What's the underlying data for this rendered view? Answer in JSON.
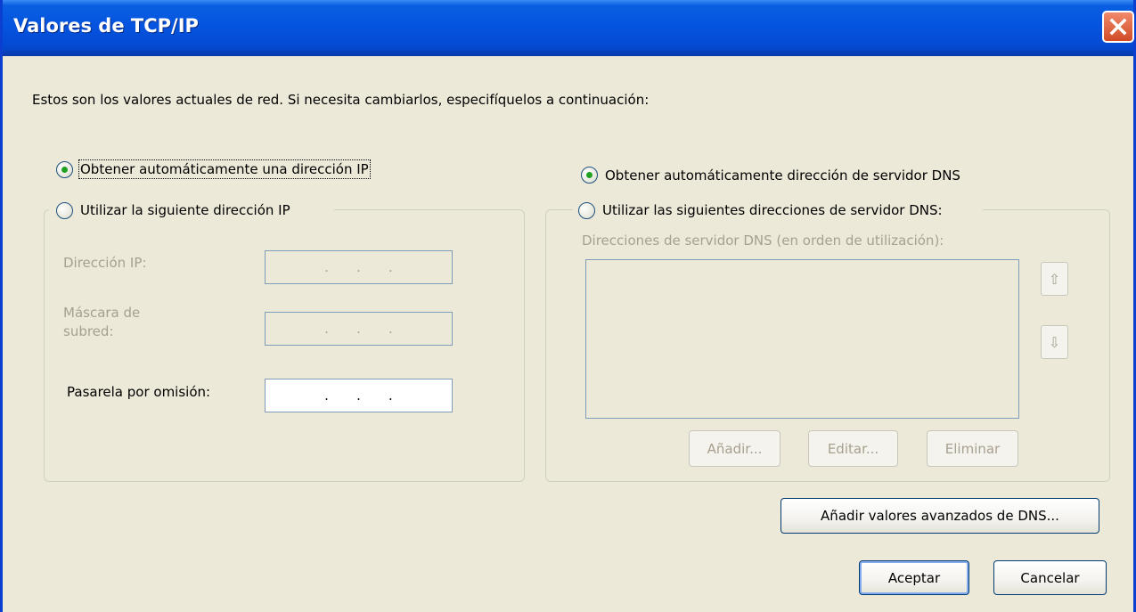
{
  "window": {
    "title": "Valores de TCP/IP",
    "close_icon": "close-icon"
  },
  "intro_text": "Estos son los valores actuales de red.  Si necesita cambiarlos, especifíquelos a continuación:",
  "ip": {
    "auto_option": "Obtener automáticamente una dirección IP",
    "auto_selected": true,
    "manual_option": "Utilizar la siguiente dirección IP",
    "ip_address_label": "Dirección IP:",
    "subnet_label_line1": "Máscara de",
    "subnet_label_line2": "subred:",
    "gateway_label": "Pasarela por omisión:",
    "dot": "."
  },
  "dns": {
    "auto_option": "Obtener automáticamente dirección de servidor DNS",
    "auto_selected": true,
    "manual_option": "Utilizar las siguientes direcciones de servidor DNS:",
    "list_label": "Direcciones de servidor DNS (en orden de utilización):",
    "up_arrow": "⇧",
    "down_arrow": "⇩",
    "add_button": "Añadir...",
    "edit_button": "Editar...",
    "remove_button": "Eliminar"
  },
  "buttons": {
    "advanced_dns": "Añadir valores avanzados de DNS...",
    "ok": "Aceptar",
    "cancel": "Cancelar"
  },
  "colors": {
    "titlebar": "#0554e0",
    "background": "#ece9d8",
    "radio_dot": "#21a121",
    "close_button": "#d14a25"
  }
}
